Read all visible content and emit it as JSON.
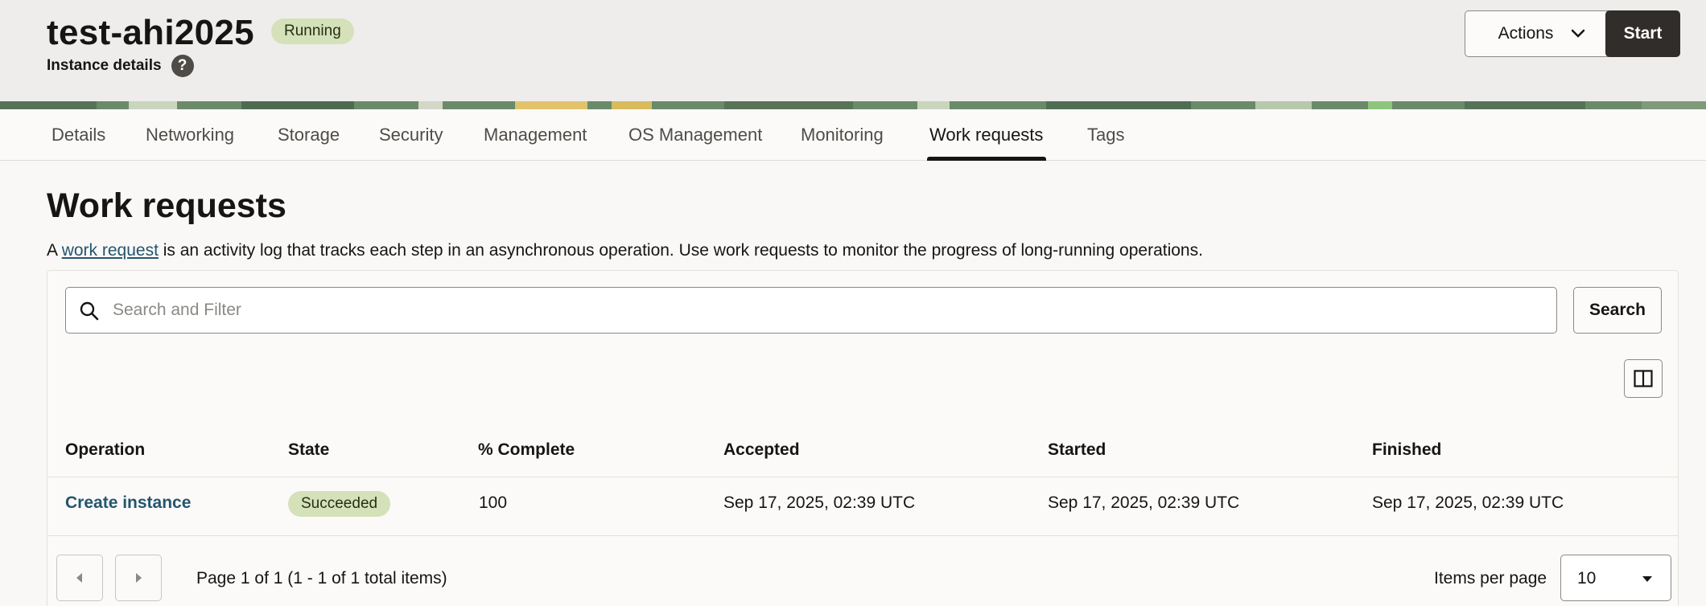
{
  "header": {
    "title": "test-ahi2025",
    "status": "Running",
    "subtitle": "Instance details",
    "help_icon": "question-circle-icon",
    "actions_label": "Actions",
    "start_label": "Start"
  },
  "tabs": [
    {
      "label": "Details"
    },
    {
      "label": "Networking"
    },
    {
      "label": "Storage"
    },
    {
      "label": "Security"
    },
    {
      "label": "Management"
    },
    {
      "label": "OS Management"
    },
    {
      "label": "Monitoring"
    },
    {
      "label": "Work requests",
      "active": true
    },
    {
      "label": "Tags"
    }
  ],
  "main": {
    "heading": "Work requests",
    "desc_prefix": "A ",
    "desc_link": "work request",
    "desc_suffix": " is an activity log that tracks each step in an asynchronous operation. Use work requests to monitor the progress of long-running operations.",
    "search_placeholder": "Search and Filter",
    "search_button": "Search",
    "columns_icon": "columns-icon"
  },
  "table": {
    "headers": [
      "Operation",
      "State",
      "% Complete",
      "Accepted",
      "Started",
      "Finished"
    ],
    "rows": [
      {
        "operation": "Create instance",
        "state": "Succeeded",
        "complete": "100",
        "accepted": "Sep 17, 2025, 02:39 UTC",
        "started": "Sep 17, 2025, 02:39 UTC",
        "finished": "Sep 17, 2025, 02:39 UTC"
      }
    ]
  },
  "pagination": {
    "info": "Page 1 of 1 (1 - 1 of 1 total items)",
    "items_per_page_label": "Items per page",
    "items_per_page_value": "10"
  },
  "colors": {
    "badge_green": "#d4e1b9",
    "link_blue": "#24556f",
    "primary_dark": "#312d2a"
  }
}
